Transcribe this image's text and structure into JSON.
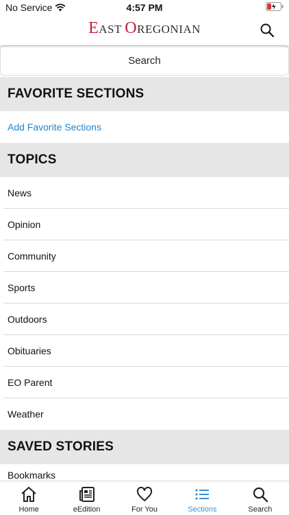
{
  "status_bar": {
    "carrier": "No Service",
    "time": "4:57 PM"
  },
  "header": {
    "logo_big_1": "E",
    "logo_small_1": "AST ",
    "logo_big_2": "O",
    "logo_small_2": "REGONIAN"
  },
  "search": {
    "label": "Search"
  },
  "favorite_sections": {
    "title": "FAVORITE SECTIONS",
    "add_link": "Add Favorite Sections"
  },
  "topics": {
    "title": "TOPICS",
    "items": [
      "News",
      "Opinion",
      "Community",
      "Sports",
      "Outdoors",
      "Obituaries",
      "EO Parent",
      "Weather"
    ]
  },
  "saved_stories": {
    "title": "SAVED STORIES",
    "items": [
      "Bookmarks"
    ]
  },
  "tab_bar": {
    "tabs": [
      {
        "label": "Home",
        "icon": "home-icon",
        "active": false
      },
      {
        "label": "eEdition",
        "icon": "newspaper-icon",
        "active": false
      },
      {
        "label": "For You",
        "icon": "heart-icon",
        "active": false
      },
      {
        "label": "Sections",
        "icon": "list-icon",
        "active": true
      },
      {
        "label": "Search",
        "icon": "search-icon",
        "active": false
      }
    ]
  },
  "colors": {
    "accent": "#3a8fd9",
    "link": "#1a86d6",
    "logo_red": "#c41e3a",
    "section_bg": "#e6e6e6"
  }
}
